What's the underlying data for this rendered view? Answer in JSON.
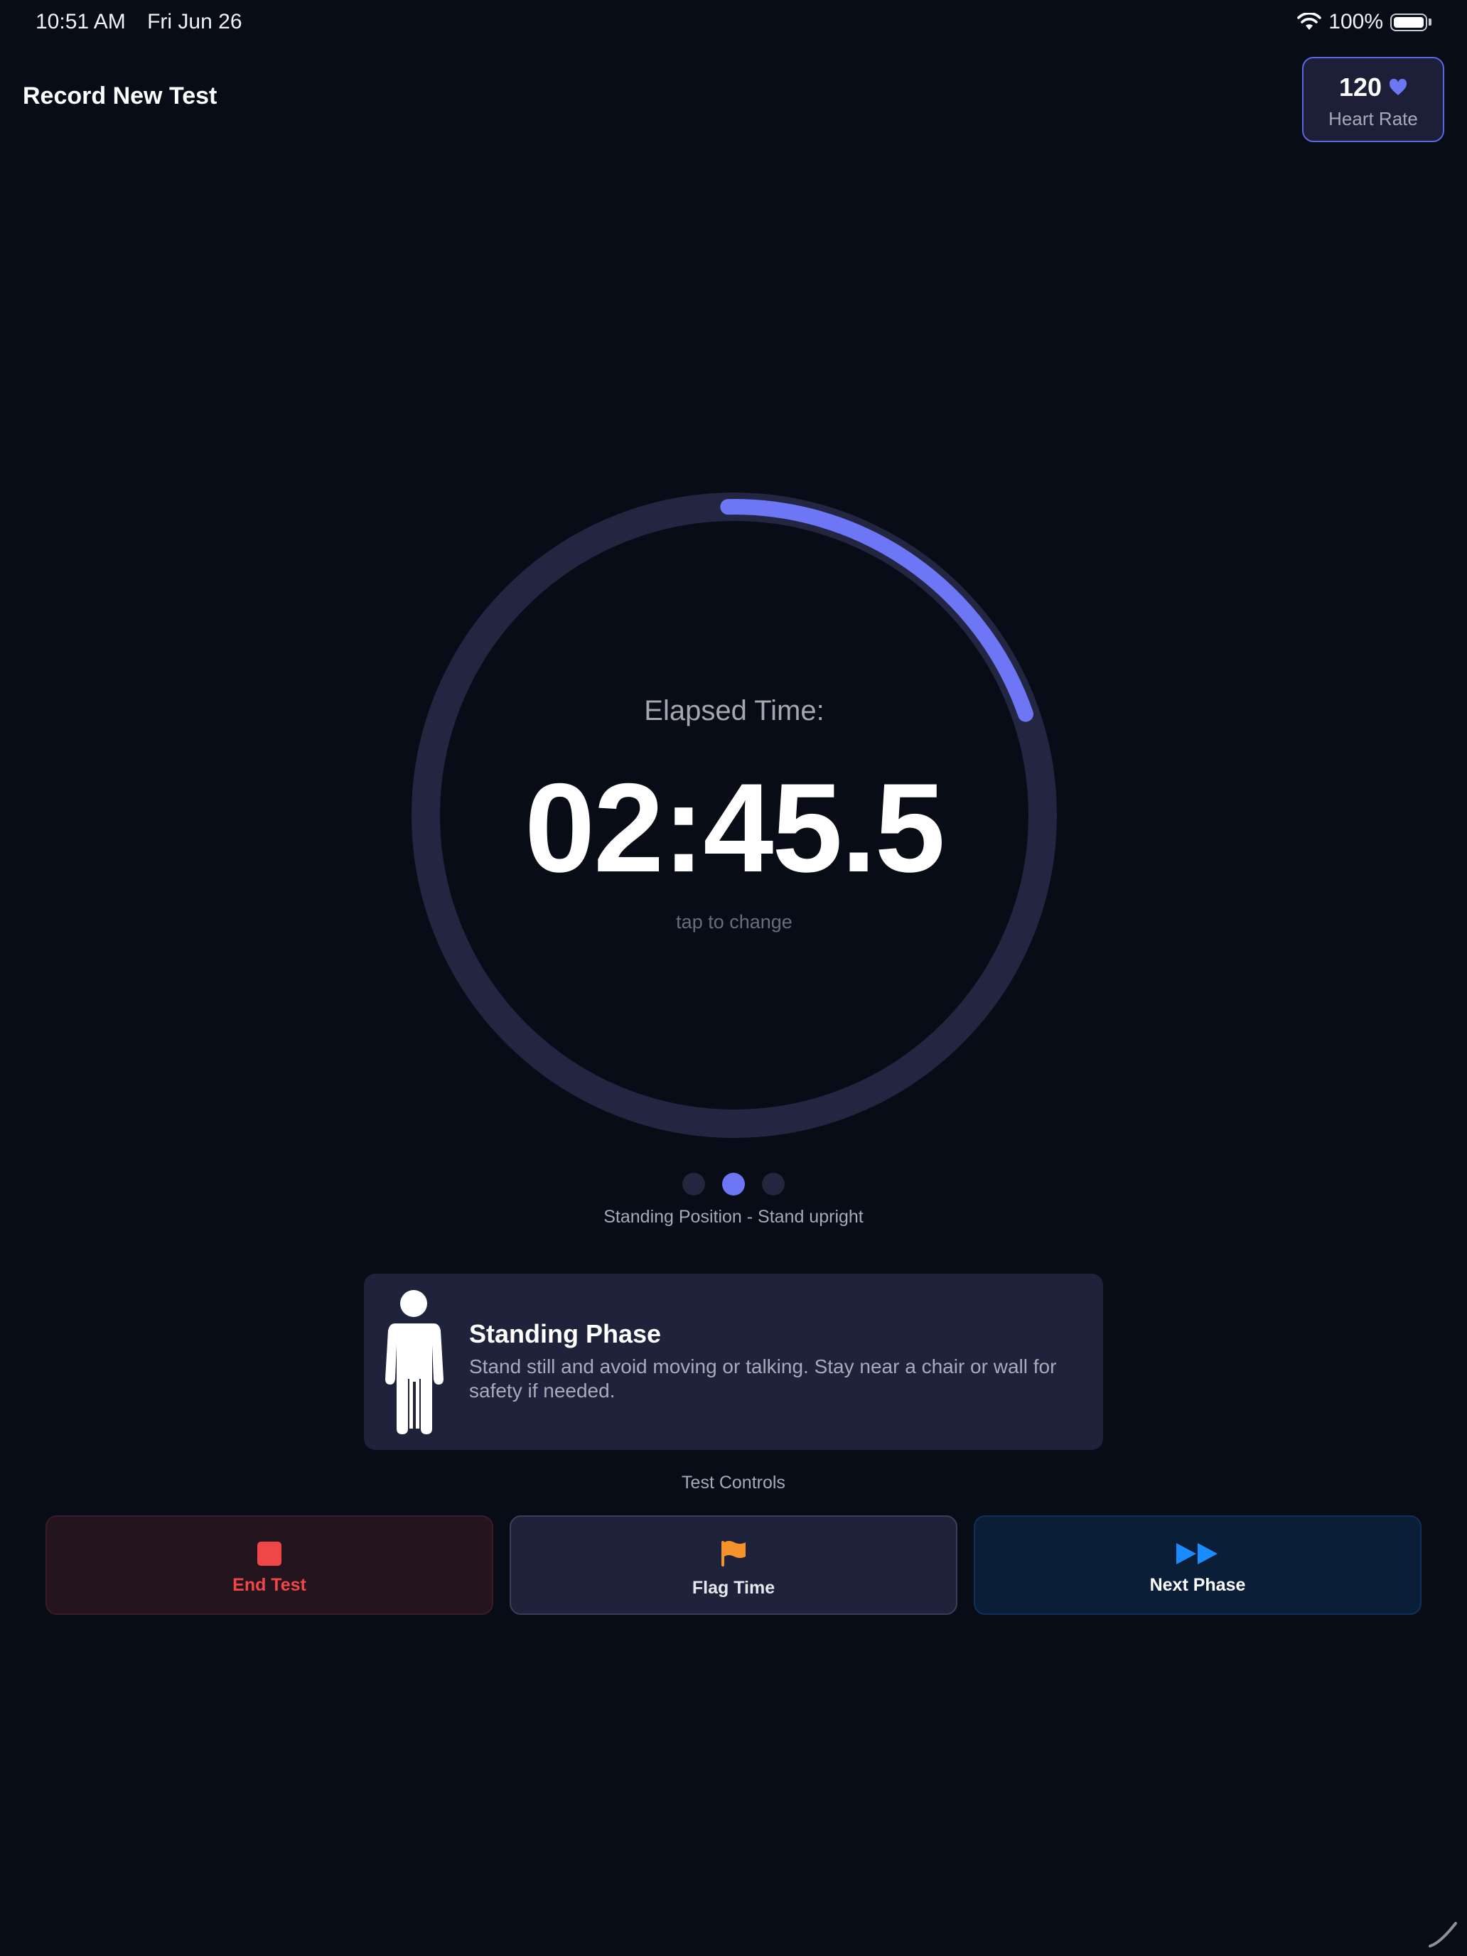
{
  "status_bar": {
    "time": "10:51 AM",
    "date": "Fri Jun 26",
    "battery": "100%",
    "icons": [
      "wifi-icon",
      "battery-icon"
    ]
  },
  "header": {
    "title": "Record New Test",
    "heart_rate": {
      "value": "120",
      "label": "Heart Rate",
      "icon": "heart-icon"
    }
  },
  "timer": {
    "label": "Elapsed Time:",
    "value": "02:45.5",
    "hint": "tap to change",
    "progress_fraction": 0.2
  },
  "phases": {
    "count": 3,
    "active_index": 1,
    "caption": "Standing Position - Stand upright"
  },
  "phase_card": {
    "icon": "standing-person-icon",
    "title": "Standing Phase",
    "description": "Stand still and avoid moving or talking. Stay near a chair or wall for safety if needed."
  },
  "controls": {
    "label": "Test Controls",
    "buttons": [
      {
        "label": "End Test",
        "icon": "stop-icon"
      },
      {
        "label": "Flag Time",
        "icon": "flag-icon"
      },
      {
        "label": "Next Phase",
        "icon": "fast-forward-icon"
      }
    ]
  },
  "colors": {
    "background": "#080c17",
    "accent": "#6d77f6",
    "ring_track": "#222640",
    "card": "#1e223a",
    "danger": "#ef4747",
    "flag": "#f5922b",
    "next": "#1a8cff"
  }
}
